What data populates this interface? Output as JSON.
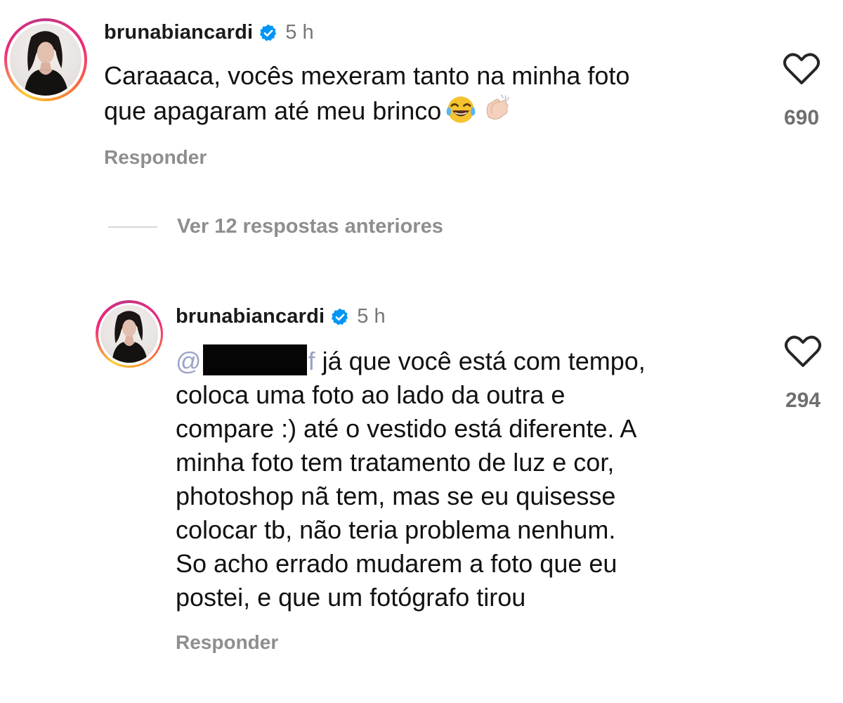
{
  "comments": [
    {
      "username": "brunabiancardi",
      "time": "5 h",
      "lines": [
        "Caraaaca, vocês mexeram tanto na minha foto",
        "que apagaram até meu brinco"
      ],
      "likes": "690",
      "reply_label": "Responder",
      "emojis": [
        "face-with-tears-of-joy-icon",
        "clapping-hands-icon"
      ]
    },
    {
      "username": "brunabiancardi",
      "time": "5 h",
      "mention_start": "@",
      "mention_end": "f",
      "first_line_rest": " já que você está com tempo,",
      "lines": [
        "coloca uma foto ao lado da outra e",
        "compare :) até o vestido está diferente. A",
        "minha foto tem tratamento de luz e cor,",
        "photoshop nã tem, mas se eu quisesse",
        "colocar tb, não teria problema nenhum.",
        "So acho errado mudarem a foto que eu",
        "postei, e que um fotógrafo tirou"
      ],
      "likes": "294",
      "reply_label": "Responder"
    }
  ],
  "view_replies": "Ver 12 respostas anteriores",
  "colors": {
    "verified": "#0095f6",
    "muted": "#8e8e8e",
    "mention": "#9aa4c6"
  }
}
